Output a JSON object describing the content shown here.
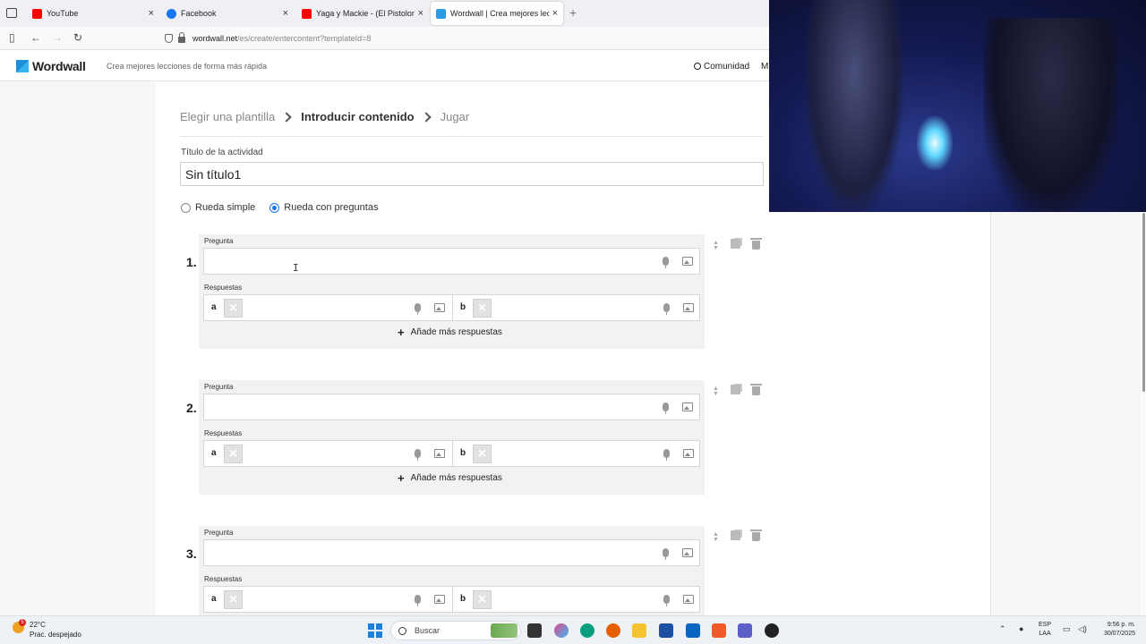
{
  "browser": {
    "tabs": [
      {
        "title": "YouTube",
        "favicon_color": "#ff0000",
        "active": false
      },
      {
        "title": "Facebook",
        "favicon_color": "#1877f2",
        "active": false
      },
      {
        "title": "Yaga y Mackie - (El Pistolon) fea",
        "favicon_color": "#ff0000",
        "active": false
      },
      {
        "title": "Wordwall | Crea mejores lecciones",
        "favicon_color": "#2b9be3",
        "active": true
      }
    ],
    "new_tab": "+",
    "url_host": "wordwall.net",
    "url_path": "/es/create/entercontent?templateId=8"
  },
  "site": {
    "logo": "Wordwall",
    "tagline": "Crea mejores lecciones de forma más rápida",
    "community": "Comunidad",
    "truncated_nav": "M"
  },
  "steps": {
    "step1": "Elegir una plantilla",
    "step2": "Introducir contenido",
    "step3": "Jugar"
  },
  "activity": {
    "title_label": "Título de la actividad",
    "title_value": "Sin título1",
    "options": [
      "Rueda simple",
      "Rueda con preguntas"
    ],
    "selected_option": "Rueda con preguntas"
  },
  "questions": [
    {
      "number": "1.",
      "question_label": "Pregunta",
      "answers_label": "Respuestas",
      "answer_letters": [
        "a",
        "b"
      ],
      "add_more": "Añade más respuestas"
    },
    {
      "number": "2.",
      "question_label": "Pregunta",
      "answers_label": "Respuestas",
      "answer_letters": [
        "a",
        "b"
      ],
      "add_more": "Añade más respuestas"
    },
    {
      "number": "3.",
      "question_label": "Pregunta",
      "answers_label": "Respuestas",
      "answer_letters": [
        "a",
        "b"
      ],
      "add_more": "Añade más respuestas"
    }
  ],
  "taskbar": {
    "weather_temp": "22°C",
    "weather_desc": "Prac. despejado",
    "weather_badge": "5",
    "search": "Buscar",
    "lang_1": "ESP",
    "lang_2": "LAA",
    "time": "9:56 p. m.",
    "date": "30/07/2025"
  },
  "colors": {
    "accent": "#1a73e8",
    "brand": "#1f8ed8"
  }
}
